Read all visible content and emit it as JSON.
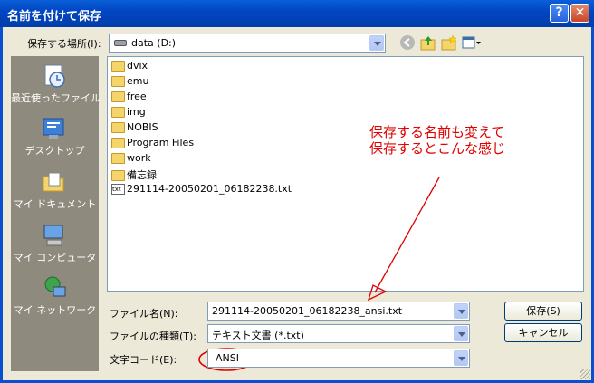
{
  "window": {
    "title": "名前を付けて保存",
    "help_label": "?",
    "close_label": "✕"
  },
  "toolbar": {
    "location_label": "保存する場所(I):",
    "location_value": "data (D:)",
    "back_icon": "back-icon",
    "up_icon": "up-folder-icon",
    "new_folder_icon": "new-folder-icon",
    "view_menu_icon": "view-menu-icon"
  },
  "places": [
    {
      "label": "最近使ったファイル",
      "icon": "recent-icon"
    },
    {
      "label": "デスクトップ",
      "icon": "desktop-icon"
    },
    {
      "label": "マイ ドキュメント",
      "icon": "my-documents-icon"
    },
    {
      "label": "マイ コンピュータ",
      "icon": "my-computer-icon"
    },
    {
      "label": "マイ ネットワーク",
      "icon": "my-network-icon"
    }
  ],
  "files": [
    {
      "name": "dvix",
      "type": "folder"
    },
    {
      "name": "emu",
      "type": "folder"
    },
    {
      "name": "free",
      "type": "folder"
    },
    {
      "name": "img",
      "type": "folder"
    },
    {
      "name": "NOBIS",
      "type": "folder"
    },
    {
      "name": "Program Files",
      "type": "folder"
    },
    {
      "name": "work",
      "type": "folder"
    },
    {
      "name": "備忘録",
      "type": "folder"
    },
    {
      "name": "291114-20050201_06182238.txt",
      "type": "txt",
      "icon_text": "txt"
    }
  ],
  "form": {
    "filename_label": "ファイル名(N):",
    "filename_value": "291114-20050201_06182238_ansi.txt",
    "filetype_label": "ファイルの種類(T):",
    "filetype_value": "テキスト文書 (*.txt)",
    "encoding_label": "文字コード(E):",
    "encoding_value": "ANSI"
  },
  "buttons": {
    "save": "保存(S)",
    "cancel": "キャンセル"
  },
  "annotation": {
    "line1": "保存する名前も変えて",
    "line2": "保存するとこんな感じ",
    "color": "#e00000"
  },
  "colors": {
    "title_bar": "#0246c4",
    "dialog_bg": "#ece9d8",
    "places_bg": "#8e8a7d"
  }
}
